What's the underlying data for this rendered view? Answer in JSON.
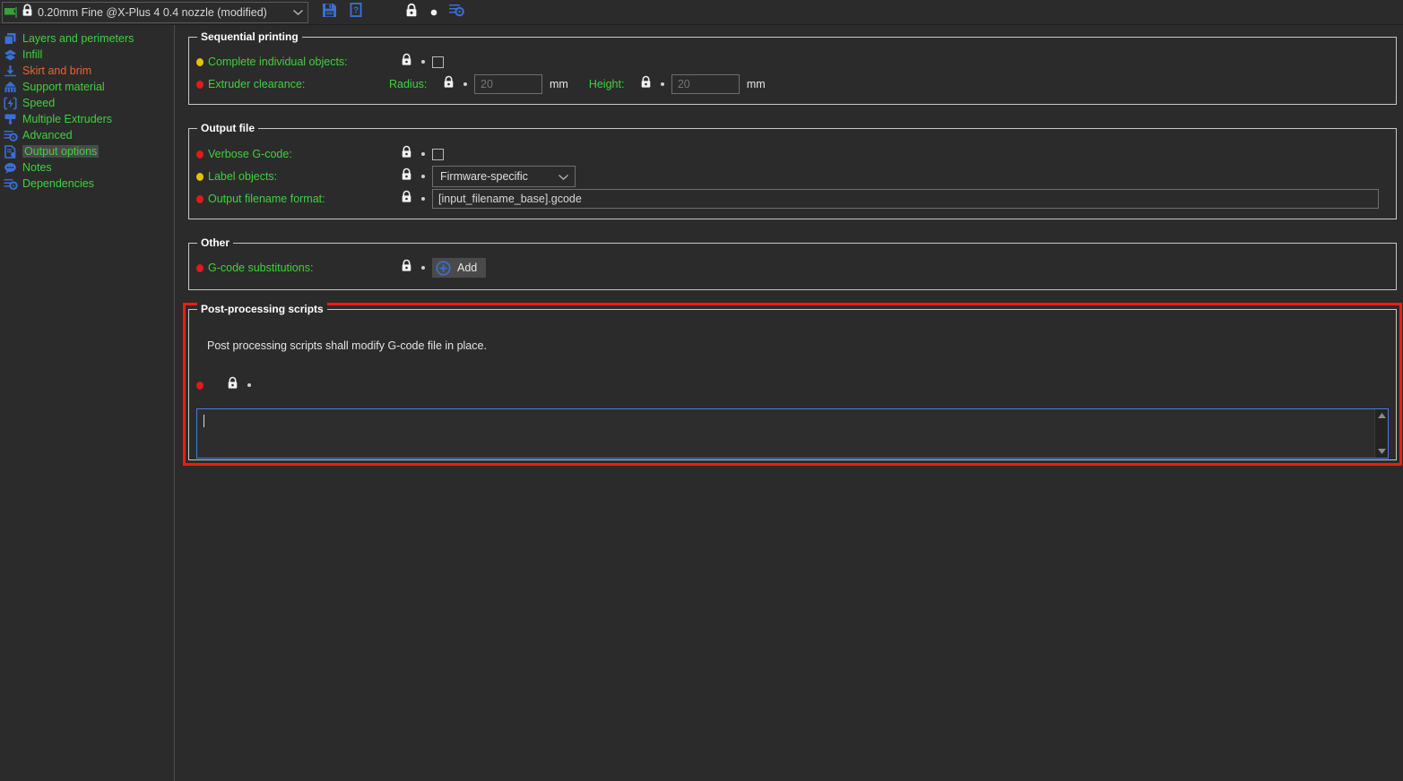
{
  "toolbar": {
    "profile_name": "0.20mm Fine @X-Plus 4 0.4 nozzle (modified)",
    "flag_icon": "green-flag-icon",
    "lock_icon": "lock-closed-icon",
    "caret_icon": "chevron-down-icon",
    "buttons": [
      {
        "name": "save-profile-button",
        "icon": "floppy-disk-icon"
      },
      {
        "name": "detach-profile-button",
        "icon": "question-document-icon"
      },
      {
        "name": "lock-toggle-button",
        "icon": "lock-closed-icon"
      },
      {
        "name": "revert-dot-button",
        "icon": "dot-icon"
      },
      {
        "name": "expert-mode-button",
        "icon": "gear-sliders-icon"
      }
    ]
  },
  "sidebar": {
    "items": [
      {
        "label": "Layers and perimeters",
        "icon": "layers-icon",
        "color": "green",
        "selected": false
      },
      {
        "label": "Infill",
        "icon": "infill-icon",
        "color": "green",
        "selected": false
      },
      {
        "label": "Skirt and brim",
        "icon": "skirt-brim-icon",
        "color": "orange",
        "selected": false
      },
      {
        "label": "Support material",
        "icon": "support-material-icon",
        "color": "green",
        "selected": false
      },
      {
        "label": "Speed",
        "icon": "speed-icon",
        "color": "green",
        "selected": false
      },
      {
        "label": "Multiple Extruders",
        "icon": "extruders-icon",
        "color": "green",
        "selected": false
      },
      {
        "label": "Advanced",
        "icon": "advanced-gear-icon",
        "color": "green",
        "selected": false
      },
      {
        "label": "Output options",
        "icon": "output-options-icon",
        "color": "green",
        "selected": true
      },
      {
        "label": "Notes",
        "icon": "notes-bubble-icon",
        "color": "green",
        "selected": false
      },
      {
        "label": "Dependencies",
        "icon": "dependencies-gear-icon",
        "color": "green",
        "selected": false
      }
    ]
  },
  "sequential_printing": {
    "title": "Sequential printing",
    "complete_individual_objects": {
      "label": "Complete individual objects:",
      "bullet": "yellow",
      "checked": false
    },
    "extruder_clearance": {
      "label": "Extruder clearance:",
      "bullet": "red",
      "radius_label": "Radius:",
      "radius_value": "20",
      "radius_unit": "mm",
      "height_label": "Height:",
      "height_value": "20",
      "height_unit": "mm"
    }
  },
  "output_file": {
    "title": "Output file",
    "verbose_gcode": {
      "label": "Verbose G-code:",
      "bullet": "red",
      "checked": false
    },
    "label_objects": {
      "label": "Label objects:",
      "bullet": "yellow",
      "value": "Firmware-specific"
    },
    "output_filename_format": {
      "label": "Output filename format:",
      "bullet": "red",
      "value": "[input_filename_base].gcode"
    }
  },
  "other": {
    "title": "Other",
    "gcode_substitutions": {
      "label": "G-code substitutions:",
      "bullet": "red",
      "add_label": "Add"
    }
  },
  "post_processing": {
    "title": "Post-processing scripts",
    "description": "Post processing scripts shall modify G-code file in place.",
    "bullet": "red",
    "script_value": "",
    "highlight_color": "#ee1c15"
  },
  "colors": {
    "background": "#2b2b2b",
    "label_green": "#3fd13f",
    "label_orange": "#e8662a",
    "icon_blue": "#3a6fd8",
    "focus_blue": "#4a7fd4",
    "bullet_red": "#e01b1b",
    "bullet_yellow": "#e3c20a"
  }
}
